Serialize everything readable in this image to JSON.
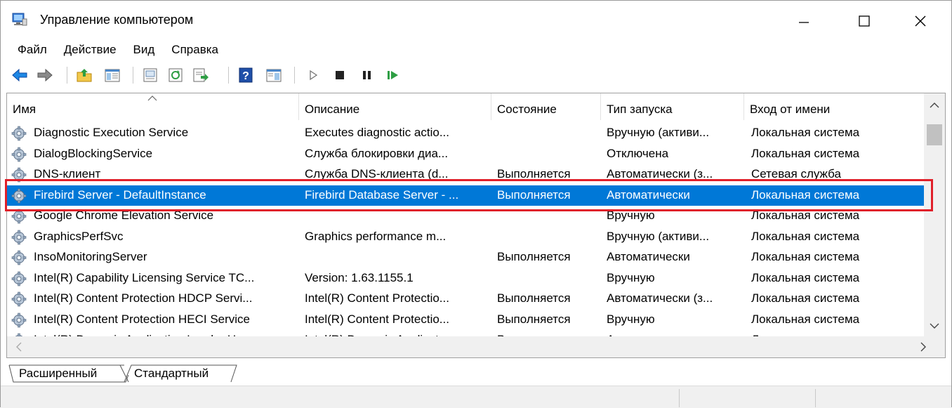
{
  "window": {
    "title": "Управление компьютером"
  },
  "menu": [
    "Файл",
    "Действие",
    "Вид",
    "Справка"
  ],
  "toolbar": {
    "buttons": [
      "back-icon",
      "forward-icon",
      "up-folder-icon",
      "show-hide-tree-icon",
      "properties-icon",
      "refresh-icon",
      "export-list-icon",
      "help-icon",
      "console-icon",
      "start-service-icon",
      "stop-service-icon",
      "pause-service-icon",
      "resume-service-icon"
    ]
  },
  "columns": [
    "Имя",
    "Описание",
    "Состояние",
    "Тип запуска",
    "Вход от имени"
  ],
  "rows": [
    {
      "name": "Diagnostic Execution Service",
      "desc": "Executes diagnostic actio...",
      "state": "",
      "start": "Вручную (активи...",
      "logon": "Локальная система"
    },
    {
      "name": "DialogBlockingService",
      "desc": "Служба блокировки диа...",
      "state": "",
      "start": "Отключена",
      "logon": "Локальная система"
    },
    {
      "name": "DNS-клиент",
      "desc": "Служба DNS-клиента (d...",
      "state": "Выполняется",
      "start": "Автоматически (з...",
      "logon": "Сетевая служба"
    },
    {
      "name": "Firebird Server - DefaultInstance",
      "desc": "Firebird Database Server - ...",
      "state": "Выполняется",
      "start": "Автоматически",
      "logon": "Локальная система"
    },
    {
      "name": "Google Chrome Elevation Service",
      "desc": "",
      "state": "",
      "start": "Вручную",
      "logon": "Локальная система"
    },
    {
      "name": "GraphicsPerfSvc",
      "desc": "Graphics performance m...",
      "state": "",
      "start": "Вручную (активи...",
      "logon": "Локальная система"
    },
    {
      "name": "InsoMonitoringServer",
      "desc": "",
      "state": "Выполняется",
      "start": "Автоматически",
      "logon": "Локальная система"
    },
    {
      "name": "Intel(R) Capability Licensing Service TC...",
      "desc": "Version: 1.63.1155.1",
      "state": "",
      "start": "Вручную",
      "logon": "Локальная система"
    },
    {
      "name": "Intel(R) Content Protection HDCP Servi...",
      "desc": "Intel(R) Content Protectio...",
      "state": "Выполняется",
      "start": "Автоматически (з...",
      "logon": "Локальная система"
    },
    {
      "name": "Intel(R) Content Protection HECI Service",
      "desc": "Intel(R) Content Protectio...",
      "state": "Выполняется",
      "start": "Вручную",
      "logon": "Локальная система"
    },
    {
      "name": "Intel(R) Dynamic Application Loader H...",
      "desc": "Intel(R) Dynamic Applicat...",
      "state": "Выполняется",
      "start": "Автоматически",
      "logon": "Локальная система"
    }
  ],
  "selected_row": "Firebird Server - DefaultInstance",
  "tabs": [
    "Расширенный",
    "Стандартный"
  ],
  "colors": {
    "selection": "#0078d7",
    "highlight_border": "#e0202a"
  }
}
